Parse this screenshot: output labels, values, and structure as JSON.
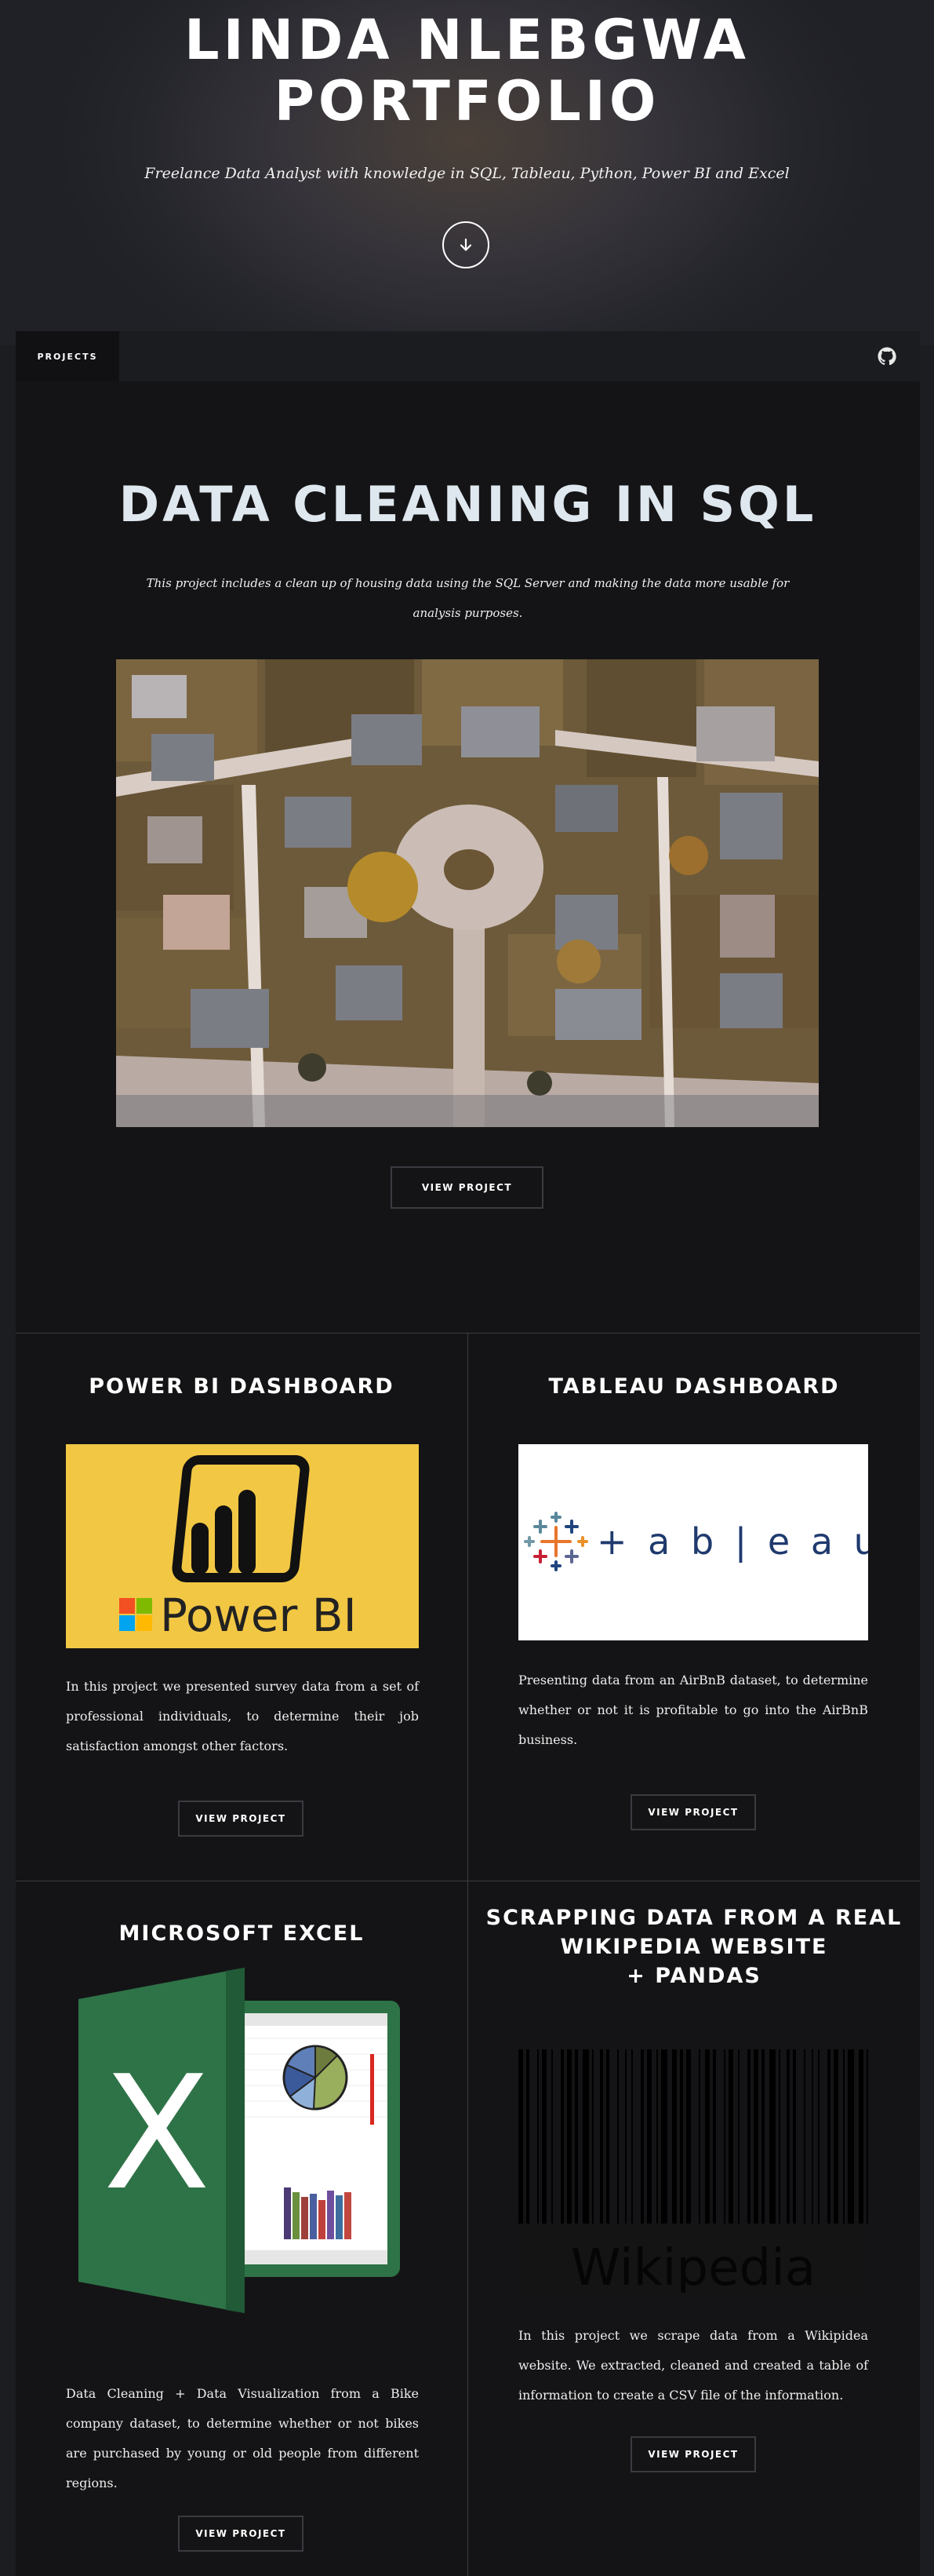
{
  "hero": {
    "title_line1": "LINDA NLEBGWA",
    "title_line2": "PORTFOLIO",
    "subtitle": "Freelance Data Analyst with knowledge in SQL, Tableau, Python, Power BI and Excel",
    "scroll_icon": "arrow-down-icon"
  },
  "nav": {
    "tab_label": "PROJECTS",
    "github_icon": "github-icon"
  },
  "featured": {
    "title": "DATA CLEANING IN SQL",
    "description": "This project includes a clean up of housing data using the SQL Server and making the data more usable for analysis purposes.",
    "button": "VIEW PROJECT"
  },
  "projects": [
    {
      "title": "POWER BI DASHBOARD",
      "logo_text": "Power BI",
      "description": "In this project we presented survey data from a set of professional individuals, to determine their job satisfaction amongst other factors.",
      "button": "VIEW PROJECT"
    },
    {
      "title": "TABLEAU DASHBOARD",
      "logo_text": "+ a b | e a u",
      "description": "Presenting data from an AirBnB dataset, to determine whether or not it is profitable to go into the AirBnB business.",
      "button": "VIEW PROJECT"
    },
    {
      "title": "MICROSOFT EXCEL",
      "logo_text": "X",
      "description": "Data Cleaning + Data Visualization from a Bike company dataset, to determine whether or not bikes are purchased by young or old people from different regions.",
      "button": "VIEW PROJECT"
    },
    {
      "title_line1": "SCRAPPING DATA FROM A REAL",
      "title_line2": "WIKIPEDIA WEBSITE",
      "title_line3": "+ PANDAS",
      "logo_text": "Wikipedia",
      "description": "In this project we scrape data from a Wikipidea website. We extracted, cleaned and created a table of information to create a CSV file of the information.",
      "button": "VIEW PROJECT"
    }
  ],
  "colors": {
    "powerbi_bg": "#f2c744",
    "excel_green": "#2e7347",
    "tableau_blue": "#1f3a6e"
  }
}
